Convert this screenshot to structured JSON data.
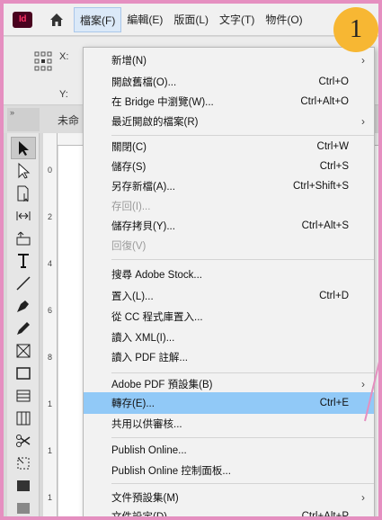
{
  "app": {
    "logo_text": "Id"
  },
  "menubar": {
    "items": [
      "檔案(F)",
      "編輯(E)",
      "版面(L)",
      "文字(T)",
      "物件(O)"
    ]
  },
  "control_bar": {
    "x_label": "X:",
    "y_label": "Y:"
  },
  "panel": {
    "collapse_label": "»",
    "doc_tab": "未命"
  },
  "ruler": {
    "numbers": [
      "0",
      "2",
      "4",
      "6",
      "8",
      "1",
      "1",
      "1"
    ]
  },
  "menu": {
    "items": [
      {
        "label": "新增(N)",
        "shortcut": "",
        "submenu": true
      },
      {
        "label": "開啟舊檔(O)...",
        "shortcut": "Ctrl+O"
      },
      {
        "label": "在 Bridge 中瀏覽(W)...",
        "shortcut": "Ctrl+Alt+O"
      },
      {
        "label": "最近開啟的檔案(R)",
        "shortcut": "",
        "submenu": true
      },
      {
        "label": "關閉(C)",
        "shortcut": "Ctrl+W"
      },
      {
        "label": "儲存(S)",
        "shortcut": "Ctrl+S"
      },
      {
        "label": "另存新檔(A)...",
        "shortcut": "Ctrl+Shift+S"
      },
      {
        "label": "存回(I)...",
        "shortcut": "",
        "disabled": true
      },
      {
        "label": "儲存拷貝(Y)...",
        "shortcut": "Ctrl+Alt+S"
      },
      {
        "label": "回復(V)",
        "shortcut": "",
        "disabled": true
      },
      {
        "label": "搜尋 Adobe Stock...",
        "shortcut": ""
      },
      {
        "label": "置入(L)...",
        "shortcut": "Ctrl+D"
      },
      {
        "label": "從 CC 程式庫置入...",
        "shortcut": ""
      },
      {
        "label": "讀入 XML(I)...",
        "shortcut": ""
      },
      {
        "label": "讀入 PDF 註解...",
        "shortcut": ""
      },
      {
        "label": "Adobe PDF 預設集(B)",
        "shortcut": "",
        "submenu": true
      },
      {
        "label": "轉存(E)...",
        "shortcut": "Ctrl+E",
        "highlighted": true
      },
      {
        "label": "共用以供審核...",
        "shortcut": ""
      },
      {
        "label": "Publish Online...",
        "shortcut": ""
      },
      {
        "label": "Publish Online 控制面板...",
        "shortcut": ""
      },
      {
        "label": "文件預設集(M)",
        "shortcut": "",
        "submenu": true
      },
      {
        "label": "文件設定(D)...",
        "shortcut": "Ctrl+Alt+P"
      }
    ]
  },
  "badge": {
    "number": "1"
  },
  "colors": {
    "highlight": "#91c9f7",
    "frame": "#e58fc0",
    "badge": "#f7b733"
  }
}
